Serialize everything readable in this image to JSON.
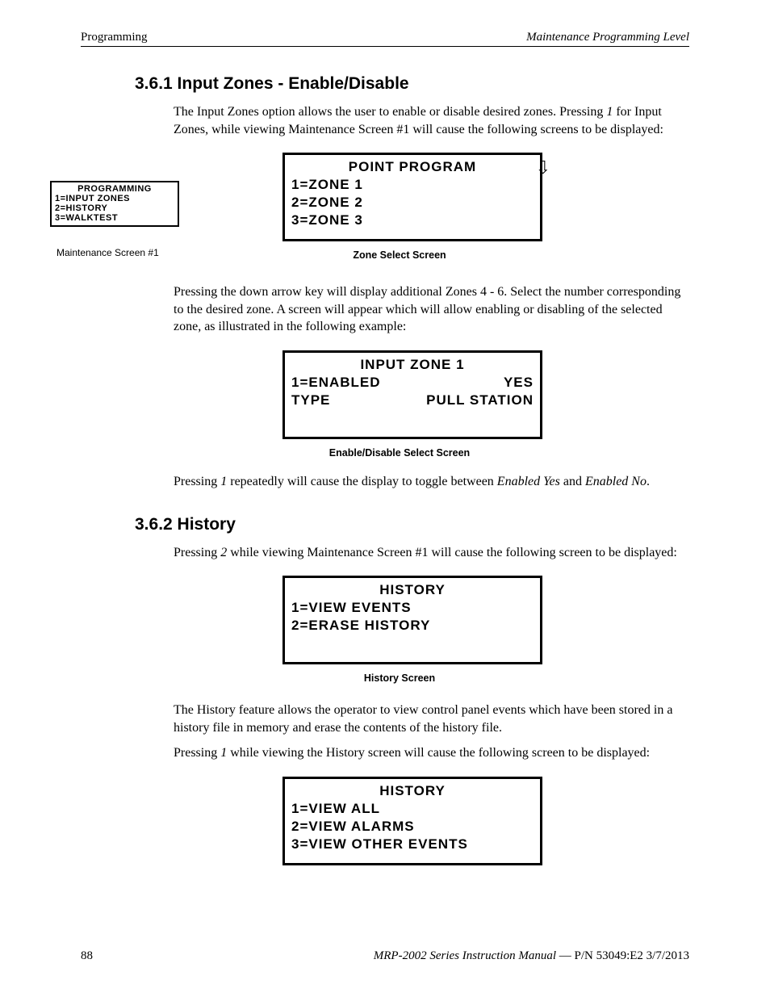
{
  "header": {
    "left": "Programming",
    "right": "Maintenance Programming Level"
  },
  "s361": {
    "heading": "3.6.1  Input Zones - Enable/Disable",
    "p1_a": "The Input Zones option allows the user to enable or disable desired zones.  Pressing ",
    "p1_i1": "1",
    "p1_b": " for Input Zones, while viewing Maintenance Screen #1 will cause the following screens to be displayed:",
    "maint_screen": {
      "title": "PROGRAMMING",
      "l1": "1=INPUT ZONES",
      "l2": "2=HISTORY",
      "l3": "3=WALKTEST",
      "caption": "Maintenance Screen #1"
    },
    "zone_select": {
      "title": "POINT PROGRAM",
      "l1": "1=ZONE 1",
      "l2": "2=ZONE 2",
      "l3": "3=ZONE 3",
      "caption": "Zone Select Screen"
    },
    "p2": "Pressing the down arrow key will display additional Zones 4 - 6.  Select the number corresponding to the desired zone. A screen will appear which will allow enabling or disabling of the selected zone, as illustrated in the following example:",
    "enable_screen": {
      "title": "INPUT ZONE 1",
      "l1_left": "1=ENABLED",
      "l1_right": "YES",
      "l2_left": "TYPE",
      "l2_right": "PULL STATION",
      "caption": "Enable/Disable Select Screen"
    },
    "p3_a": "Pressing ",
    "p3_i1": "1",
    "p3_b": " repeatedly will cause the display to toggle between ",
    "p3_i2": "Enabled Yes",
    "p3_c": " and ",
    "p3_i3": "Enabled No",
    "p3_d": "."
  },
  "s362": {
    "heading": "3.6.2  History",
    "p1_a": "Pressing ",
    "p1_i1": "2",
    "p1_b": " while viewing Maintenance Screen #1 will cause the following screen to be displayed:",
    "history_screen": {
      "title": "HISTORY",
      "l1": "1=VIEW EVENTS",
      "l2": "2=ERASE HISTORY",
      "caption": "History Screen"
    },
    "p2": "The History feature allows the operator to view control panel events which have been stored in a history file in memory and erase the contents of the history file.",
    "p3_a": "Pressing ",
    "p3_i1": "1",
    "p3_b": " while viewing the History screen will cause the following screen to be displayed:",
    "history2_screen": {
      "title": "HISTORY",
      "l1": "1=VIEW ALL",
      "l2": "2=VIEW ALARMS",
      "l3": "3=VIEW OTHER EVENTS"
    }
  },
  "footer": {
    "page": "88",
    "title": "MRP-2002 Series Instruction Manual",
    "sep": " — ",
    "pn": "P/N 53049:E2  3/7/2013"
  }
}
